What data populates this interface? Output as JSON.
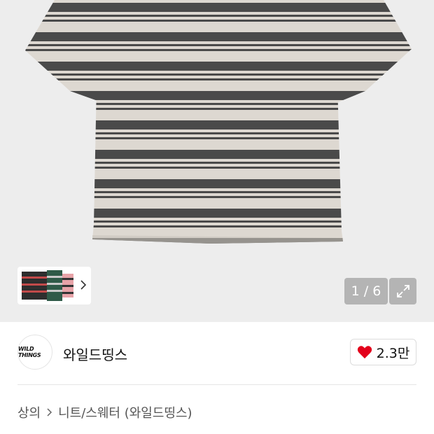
{
  "gallery": {
    "page_indicator": "1 / 6",
    "current_page": 1,
    "total_pages": 6
  },
  "brand": {
    "logo_text": "WILD THINGS",
    "name": "와일드띵스"
  },
  "like": {
    "count": "2.3만",
    "liked": true,
    "heart_color": "#e3001b"
  },
  "breadcrumb": {
    "items": [
      "상의",
      "니트/스웨터 (와일드띵스)"
    ]
  },
  "icons": {
    "thumb_next": "chevron-right-icon",
    "expand": "expand-icon",
    "heart": "heart-icon",
    "separator": "chevron-right-icon"
  },
  "colors": {
    "stripe_dark": "#4a4a4a",
    "stripe_light": "#ddd8d1",
    "background": "#ededed"
  }
}
